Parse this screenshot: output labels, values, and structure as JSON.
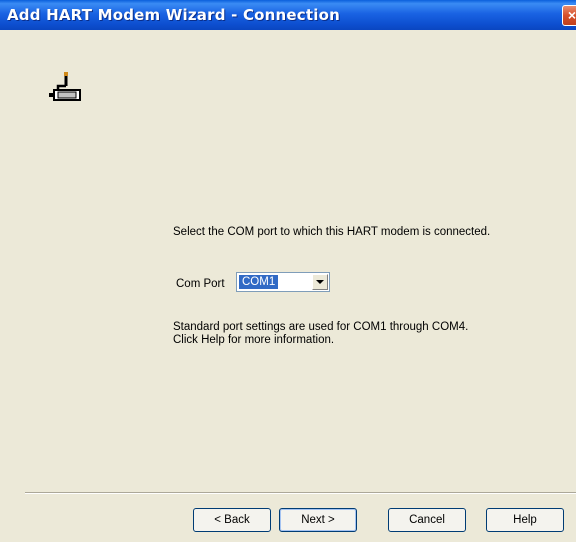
{
  "window": {
    "title": "Add HART Modem Wizard - Connection",
    "close_label": "×"
  },
  "icons": {
    "header_icon": "modem-connector-icon",
    "close": "close-icon",
    "dropdown": "chevron-down-icon"
  },
  "content": {
    "instruction": "Select the COM port to which this HART modem is connected.",
    "com_port_label": "Com Port",
    "com_port_value": "COM1",
    "note": "Standard port settings are used for COM1 through COM4.  Click Help for more information."
  },
  "buttons": {
    "back": "< Back",
    "next": "Next >",
    "cancel": "Cancel",
    "help": "Help"
  },
  "colors": {
    "titlebar": "#0a5fdc",
    "window_bg": "#ece9d8",
    "selection": "#316ac5",
    "close_button": "#d6502b"
  }
}
